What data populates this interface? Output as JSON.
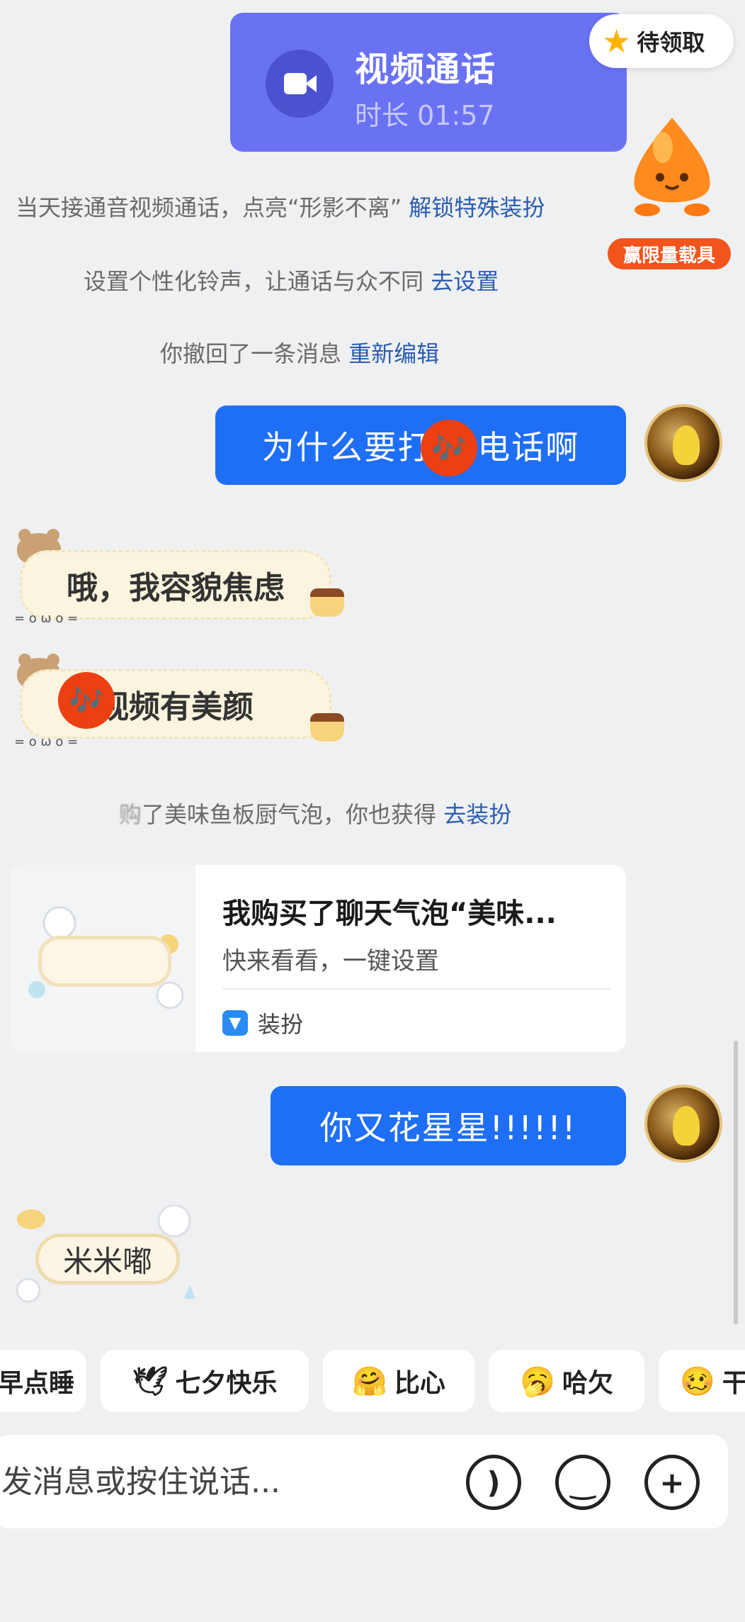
{
  "video_call": {
    "title": "视频通话",
    "duration": "时长 01:57"
  },
  "reward": {
    "label": "待领取",
    "badge": "赢限量载具"
  },
  "system_lines": [
    {
      "text": "当天接通音视频通话，点亮“形影不离”",
      "link": "解锁特殊装扮"
    },
    {
      "text": "设置个性化铃声，让通话与众不同",
      "link": "去设置"
    },
    {
      "text": "你撤回了一条消息",
      "link": "重新编辑"
    },
    {
      "text": "了美味鱼板厨气泡，你也获得",
      "link": "去装扮"
    }
  ],
  "messages": {
    "sent_1": "为什么要打  音电话啊",
    "recv_1": "哦，我容貌焦虑",
    "recv_2": "  视频有美颜",
    "sent_2": "你又花星星!!!!!!",
    "recv_3": "米米嘟"
  },
  "bubble_face": "= o ω o =",
  "music_glyph": "🎶",
  "share_card": {
    "title": "我购买了聊天气泡“美味...",
    "subtitle": "快来看看，一键设置",
    "tag": "装扮"
  },
  "quick_replies": [
    "早点睡",
    "七夕快乐",
    "比心",
    "哈欠",
    "干"
  ],
  "input": {
    "placeholder": "发消息或按住说话..."
  },
  "colors": {
    "sent_bubble": "#1e6ff5",
    "call_card": "#6a72f4",
    "link": "#2a5db0",
    "badge": "#f2541c"
  }
}
